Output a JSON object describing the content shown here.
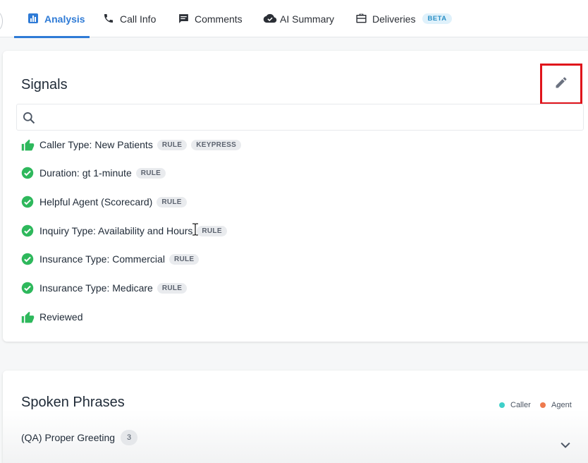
{
  "tabs": [
    {
      "label": "Analysis",
      "icon": "bar-chart-icon",
      "active": true
    },
    {
      "label": "Call Info",
      "icon": "phone-icon"
    },
    {
      "label": "Comments",
      "icon": "comment-icon"
    },
    {
      "label": "AI Summary",
      "icon": "cloud-check-icon"
    },
    {
      "label": "Deliveries",
      "icon": "briefcase-icon",
      "badge": "BETA"
    }
  ],
  "signals": {
    "title": "Signals",
    "search_placeholder": "",
    "items": [
      {
        "label": "Caller Type: New Patients",
        "icon": "thumbs-up-icon",
        "tags": [
          "RULE",
          "KEYPRESS"
        ]
      },
      {
        "label": "Duration: gt 1-minute",
        "icon": "check-circle-icon",
        "tags": [
          "RULE"
        ]
      },
      {
        "label": "Helpful Agent (Scorecard)",
        "icon": "check-circle-icon",
        "tags": [
          "RULE"
        ]
      },
      {
        "label": "Inquiry Type: Availability and Hours",
        "icon": "check-circle-icon",
        "tags": [
          "RULE"
        ]
      },
      {
        "label": "Insurance Type: Commercial",
        "icon": "check-circle-icon",
        "tags": [
          "RULE"
        ]
      },
      {
        "label": "Insurance Type: Medicare",
        "icon": "check-circle-icon",
        "tags": [
          "RULE"
        ]
      },
      {
        "label": "Reviewed",
        "icon": "thumbs-up-icon",
        "tags": []
      }
    ]
  },
  "phrases": {
    "title": "Spoken Phrases",
    "legend": [
      {
        "label": "Caller",
        "color": "#3fd0c9"
      },
      {
        "label": "Agent",
        "color": "#ee7a4e"
      }
    ],
    "items": [
      {
        "label": "(QA) Proper Greeting",
        "count": "3"
      }
    ]
  },
  "colors": {
    "accent": "#2f7bd6",
    "success": "#2eb85c",
    "highlight": "#e0141b"
  }
}
